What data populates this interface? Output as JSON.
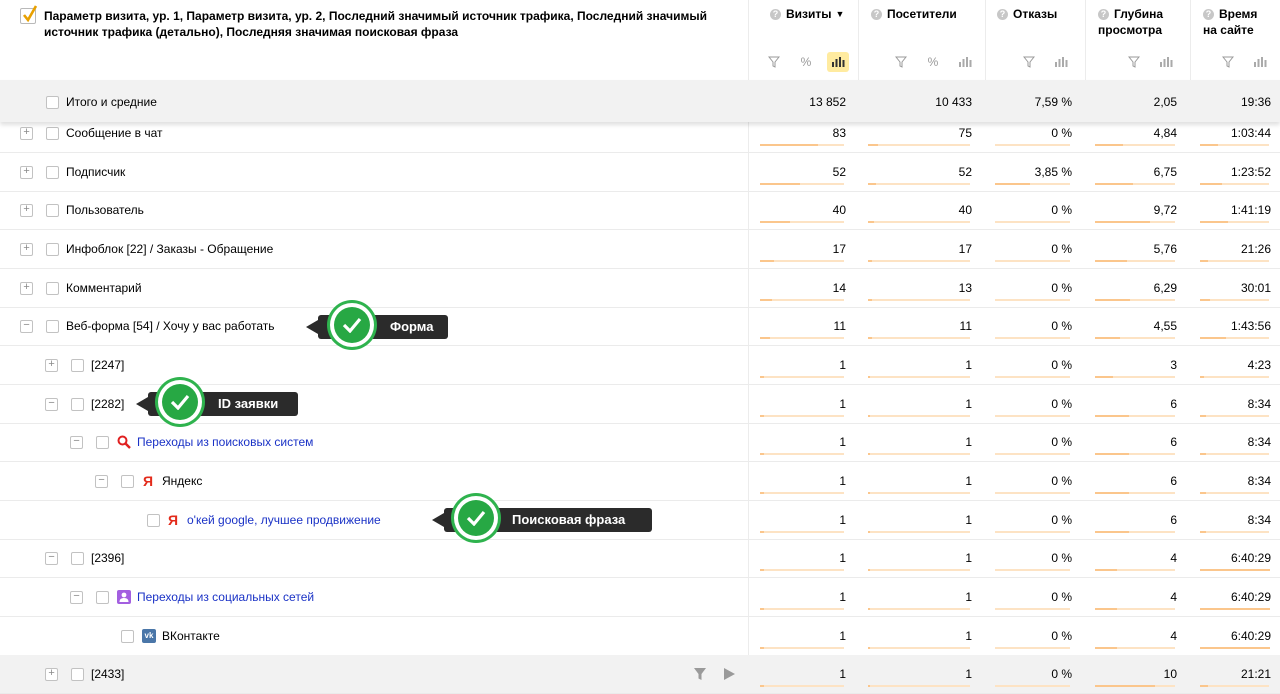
{
  "header": {
    "title": "Параметр визита, ур. 1, Параметр визита, ур. 2, Последний значимый источник трафика, Последний значимый источник трафика (детально), Последняя значимая поисковая фраза",
    "columns": [
      {
        "label": "Визиты",
        "sort": "▼"
      },
      {
        "label": "Посетители"
      },
      {
        "label": "Отказы"
      },
      {
        "label": "Глубина просмотра"
      },
      {
        "label": "Время на сайте"
      }
    ]
  },
  "totals": {
    "label": "Итого и средние",
    "visits": "13 852",
    "visitors": "10 433",
    "bounce": "7,59 %",
    "depth": "2,05",
    "time": "19:36"
  },
  "rows": [
    {
      "label": "Сообщение в чат",
      "visits": "83",
      "visitors": "75",
      "bounce": "0 %",
      "depth": "4,84",
      "time": "1:03:44"
    },
    {
      "label": "Подписчик",
      "visits": "52",
      "visitors": "52",
      "bounce": "3,85 %",
      "depth": "6,75",
      "time": "1:23:52"
    },
    {
      "label": "Пользователь",
      "visits": "40",
      "visitors": "40",
      "bounce": "0 %",
      "depth": "9,72",
      "time": "1:41:19"
    },
    {
      "label": "Инфоблок [22] / Заказы - Обращение",
      "visits": "17",
      "visitors": "17",
      "bounce": "0 %",
      "depth": "5,76",
      "time": "21:26"
    },
    {
      "label": "Комментарий",
      "visits": "14",
      "visitors": "13",
      "bounce": "0 %",
      "depth": "6,29",
      "time": "30:01"
    },
    {
      "label": "Веб-форма [54] / Хочу у вас работать",
      "visits": "11",
      "visitors": "11",
      "bounce": "0 %",
      "depth": "4,55",
      "time": "1:43:56"
    },
    {
      "label": "[2247]",
      "visits": "1",
      "visitors": "1",
      "bounce": "0 %",
      "depth": "3",
      "time": "4:23"
    },
    {
      "label": "[2282]",
      "visits": "1",
      "visitors": "1",
      "bounce": "0 %",
      "depth": "6",
      "time": "8:34"
    },
    {
      "label": "Переходы из поисковых систем",
      "visits": "1",
      "visitors": "1",
      "bounce": "0 %",
      "depth": "6",
      "time": "8:34"
    },
    {
      "label": "Яндекс",
      "visits": "1",
      "visitors": "1",
      "bounce": "0 %",
      "depth": "6",
      "time": "8:34"
    },
    {
      "label": "о'кей google, лучшее продвижение",
      "visits": "1",
      "visitors": "1",
      "bounce": "0 %",
      "depth": "6",
      "time": "8:34"
    },
    {
      "label": "[2396]",
      "visits": "1",
      "visitors": "1",
      "bounce": "0 %",
      "depth": "4",
      "time": "6:40:29"
    },
    {
      "label": "Переходы из социальных сетей",
      "visits": "1",
      "visitors": "1",
      "bounce": "0 %",
      "depth": "4",
      "time": "6:40:29"
    },
    {
      "label": "ВКонтакте",
      "visits": "1",
      "visitors": "1",
      "bounce": "0 %",
      "depth": "4",
      "time": "6:40:29"
    },
    {
      "label": "[2433]",
      "visits": "1",
      "visitors": "1",
      "bounce": "0 %",
      "depth": "10",
      "time": "21:21"
    }
  ],
  "callouts": {
    "form": "Форма",
    "request_id": "ID заявки",
    "search_phrase": "Поисковая фраза"
  },
  "icons": {
    "yandex": "Я",
    "vk": "vk"
  }
}
